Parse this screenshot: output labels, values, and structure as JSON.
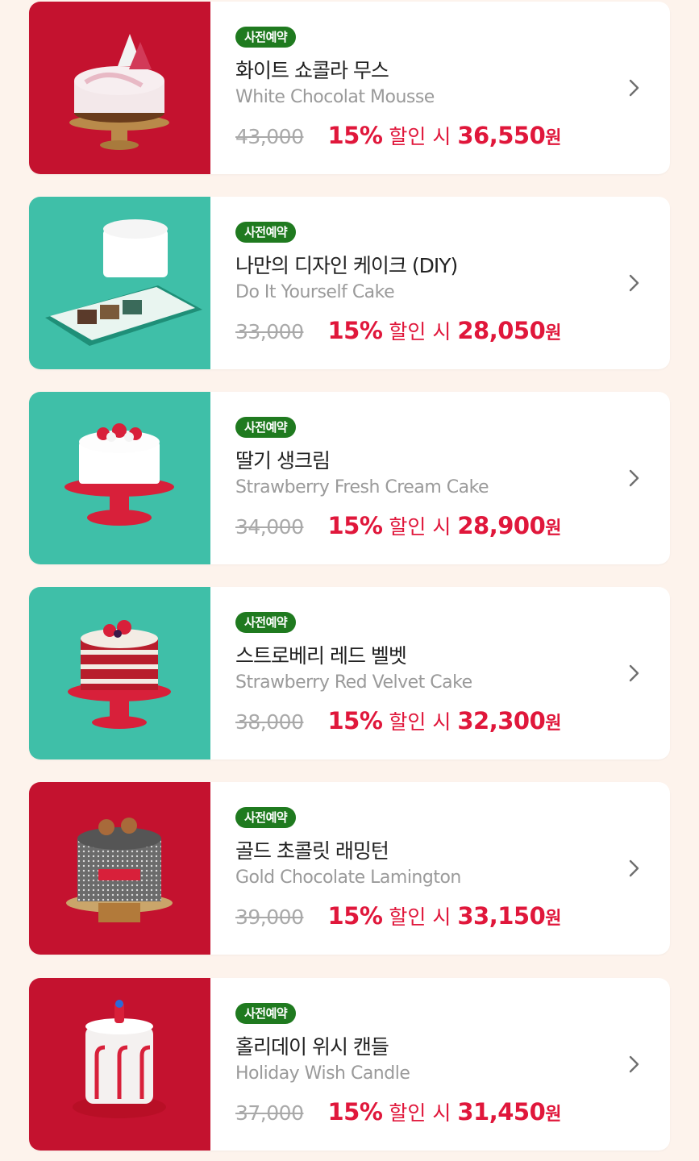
{
  "products": [
    {
      "badge": "사전예약",
      "name_ko": "화이트 쇼콜라 무스",
      "name_en": "White Chocolat Mousse",
      "original_price": "43,000",
      "discount": "15%",
      "discount_label": "할인 시",
      "sale_price": "36,550",
      "currency": "원",
      "thumb_bg": "#c4122f",
      "image": "white-chocolate-mousse-cake-photo"
    },
    {
      "badge": "사전예약",
      "name_ko": "나만의 디자인 케이크 (DIY)",
      "name_en": "Do It Yourself Cake",
      "original_price": "33,000",
      "discount": "15%",
      "discount_label": "할인 시",
      "sale_price": "28,050",
      "currency": "원",
      "thumb_bg": "#3fbfa8",
      "image": "diy-cake-kit-photo"
    },
    {
      "badge": "사전예약",
      "name_ko": "딸기 생크림",
      "name_en": "Strawberry Fresh Cream Cake",
      "original_price": "34,000",
      "discount": "15%",
      "discount_label": "할인 시",
      "sale_price": "28,900",
      "currency": "원",
      "thumb_bg": "#3fbfa8",
      "image": "strawberry-fresh-cream-cake-photo"
    },
    {
      "badge": "사전예약",
      "name_ko": "스트로베리 레드 벨벳",
      "name_en": "Strawberry Red Velvet Cake",
      "original_price": "38,000",
      "discount": "15%",
      "discount_label": "할인 시",
      "sale_price": "32,300",
      "currency": "원",
      "thumb_bg": "#3fbfa8",
      "image": "strawberry-red-velvet-cake-photo"
    },
    {
      "badge": "사전예약",
      "name_ko": "골드 초콜릿 래밍턴",
      "name_en": "Gold Chocolate Lamington",
      "original_price": "39,000",
      "discount": "15%",
      "discount_label": "할인 시",
      "sale_price": "33,150",
      "currency": "원",
      "thumb_bg": "#c4122f",
      "image": "gold-chocolate-lamington-cake-photo"
    },
    {
      "badge": "사전예약",
      "name_ko": "홀리데이 위시 캔들",
      "name_en": "Holiday Wish Candle",
      "original_price": "37,000",
      "discount": "15%",
      "discount_label": "할인 시",
      "sale_price": "31,450",
      "currency": "원",
      "thumb_bg": "#c4122f",
      "image": "holiday-wish-candle-cake-photo"
    }
  ],
  "colors": {
    "page_bg": "#fdf3ec",
    "badge_green": "#1f7a1f",
    "sale_red": "#e0173b",
    "muted_gray": "#9a9a9a"
  },
  "icons": {
    "chevron": "chevron-right-icon"
  }
}
